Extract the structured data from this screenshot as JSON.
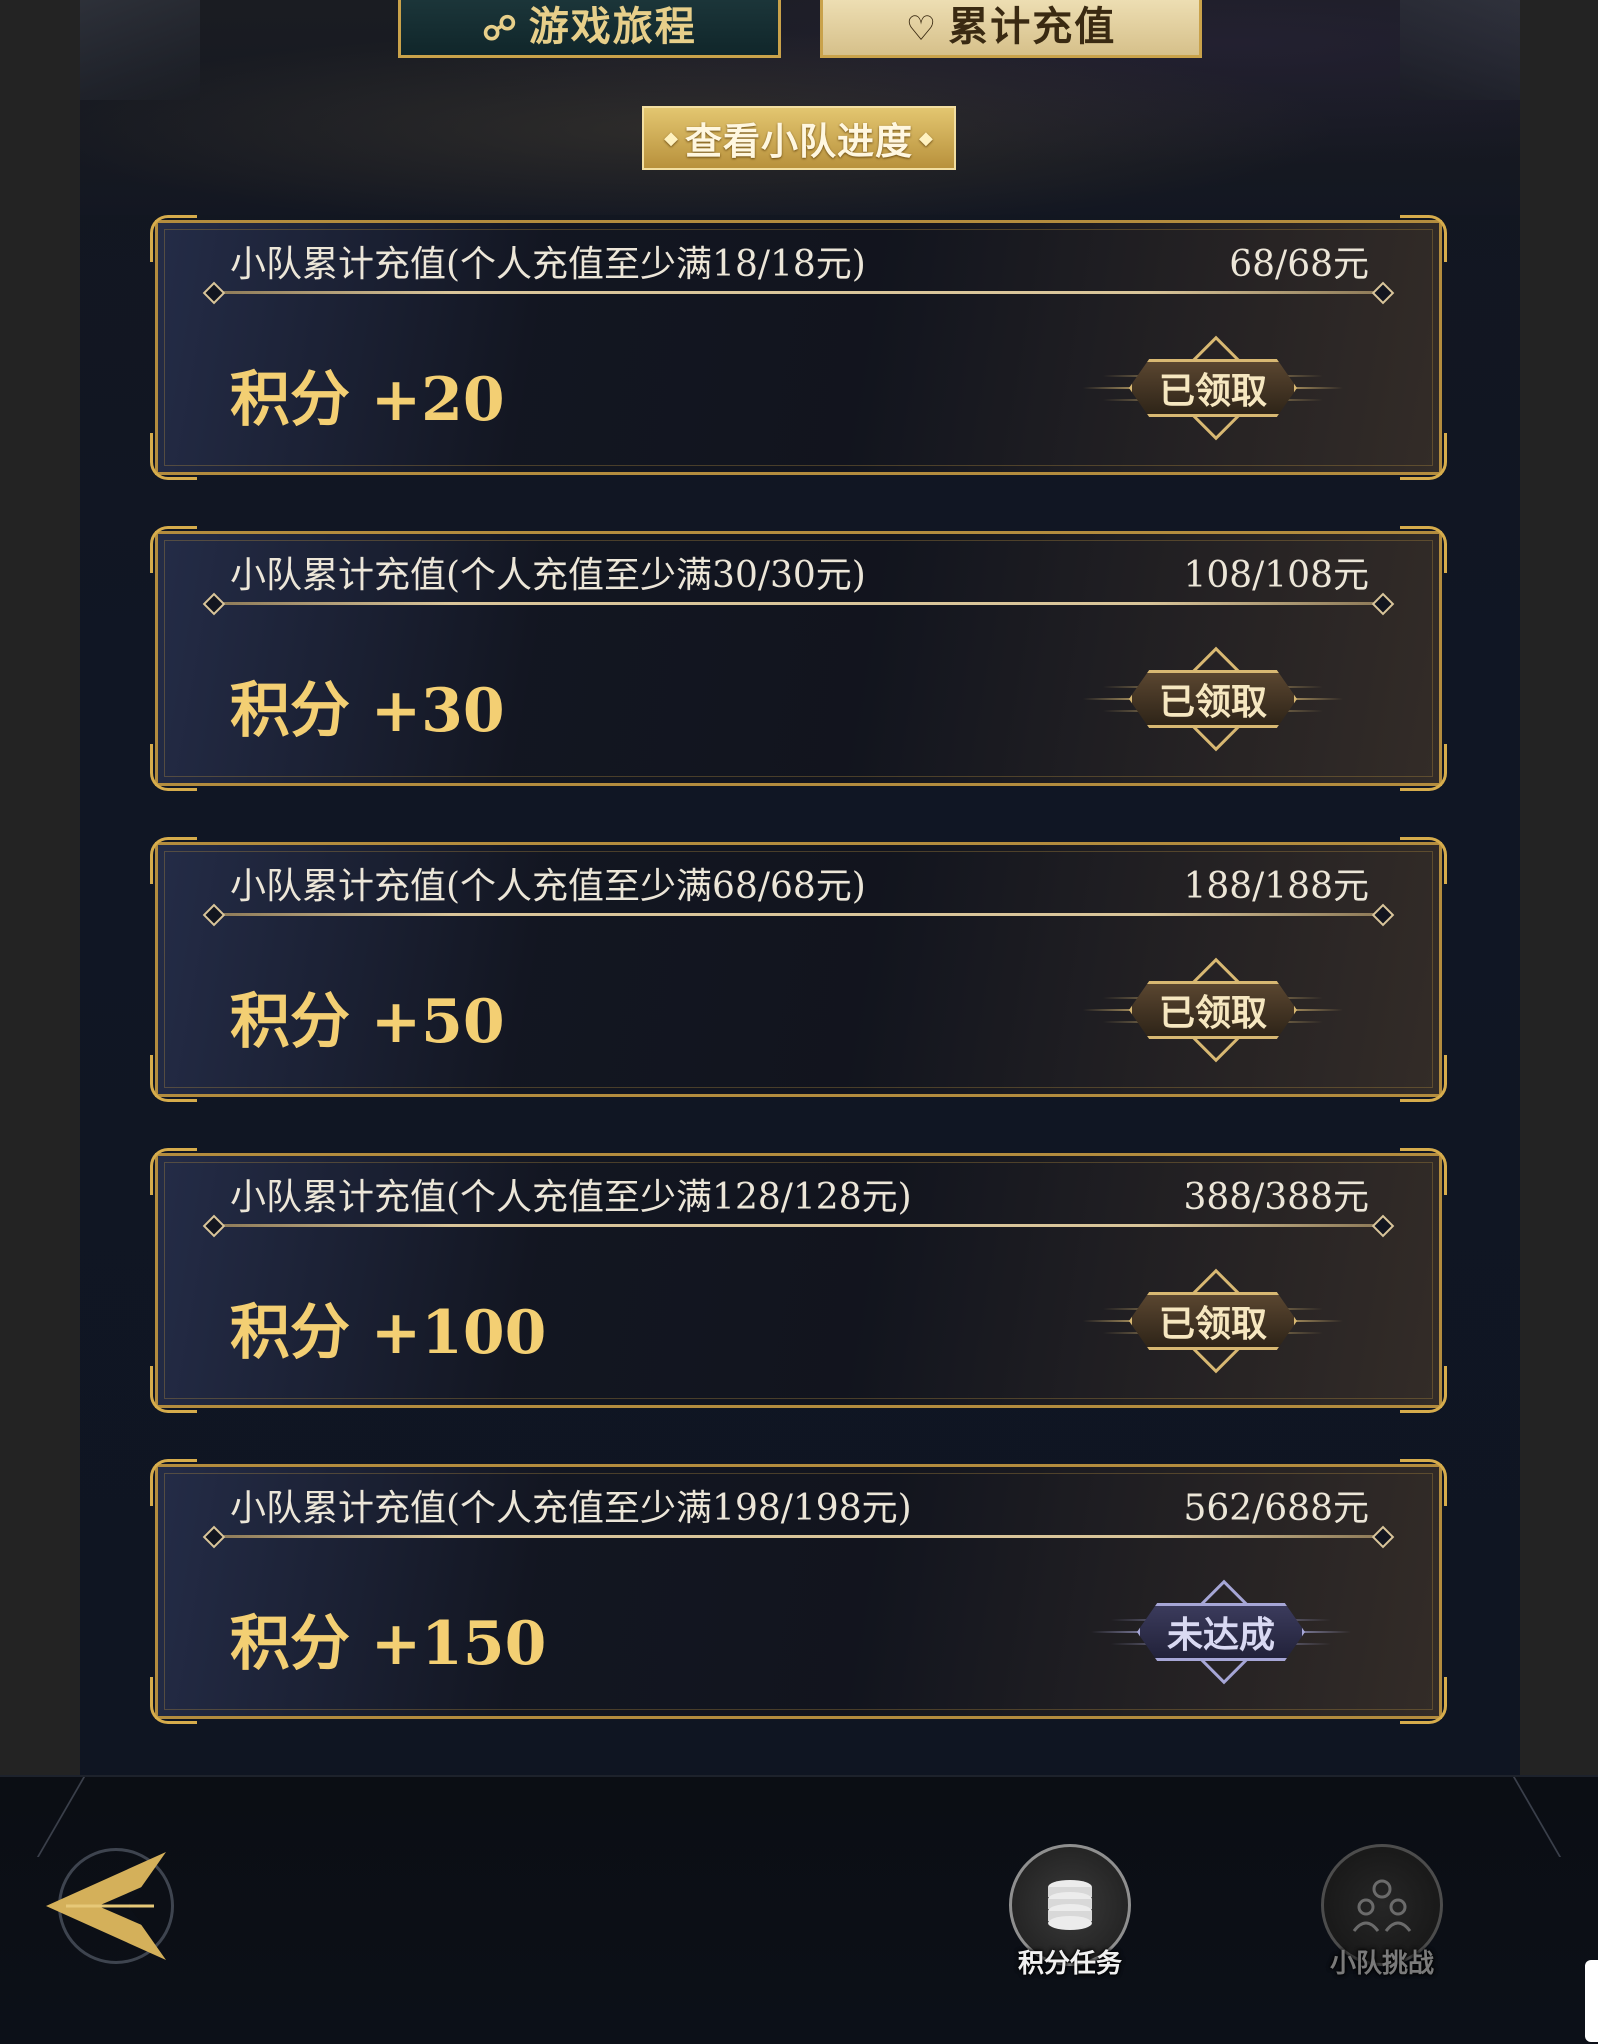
{
  "tabs": {
    "journey": {
      "label": "游戏旅程",
      "icon": "shield-icon"
    },
    "recharge": {
      "label": "累计充值",
      "icon": "heart-plus-icon"
    }
  },
  "progress_button": {
    "label": "查看小队进度"
  },
  "cards": [
    {
      "condition": "小队累计充值(个人充值至少满18/18元)",
      "progress": "68/68元",
      "reward": "积分 +20",
      "status": "已领取",
      "state": "claimed"
    },
    {
      "condition": "小队累计充值(个人充值至少满30/30元)",
      "progress": "108/108元",
      "reward": "积分 +30",
      "status": "已领取",
      "state": "claimed"
    },
    {
      "condition": "小队累计充值(个人充值至少满68/68元)",
      "progress": "188/188元",
      "reward": "积分 +50",
      "status": "已领取",
      "state": "claimed"
    },
    {
      "condition": "小队累计充值(个人充值至少满128/128元)",
      "progress": "388/388元",
      "reward": "积分 +100",
      "status": "已领取",
      "state": "claimed"
    },
    {
      "condition": "小队累计充值(个人充值至少满198/198元)",
      "progress": "562/688元",
      "reward": "积分 +150",
      "status": "未达成",
      "state": "pending"
    }
  ],
  "bottom_nav": {
    "back": {
      "icon": "back-arrow-icon"
    },
    "items": [
      {
        "label": "积分任务",
        "icon": "coin-stack-icon",
        "active": true
      },
      {
        "label": "小队挑战",
        "icon": "team-icon",
        "active": false
      }
    ]
  },
  "colors": {
    "gold": "#d6ac4c",
    "reward_text": "#f3cf73",
    "claimed_accent": "#d8b872",
    "pending_accent": "#a6a6d6"
  }
}
